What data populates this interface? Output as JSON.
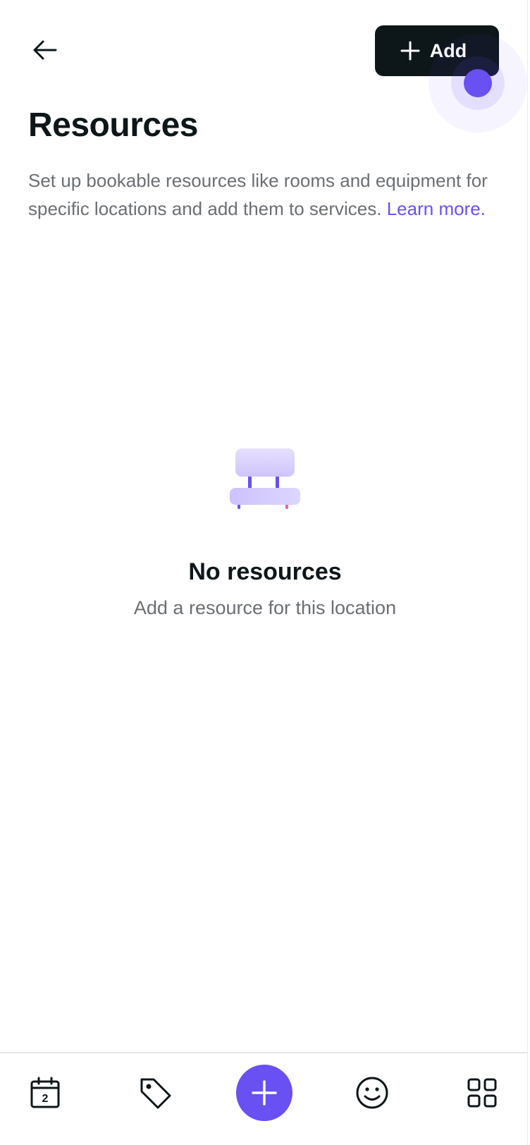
{
  "header": {
    "back_label": "Back",
    "add_label": "Add"
  },
  "page": {
    "title": "Resources",
    "description": "Set up bookable resources like rooms and equipment for specific locations and add them to services.",
    "learn_more": "Learn more."
  },
  "empty_state": {
    "icon": "chair-icon",
    "title": "No resources",
    "subtitle": "Add a resource for this location"
  },
  "bottom_nav": {
    "items": [
      {
        "name": "calendar",
        "icon": "calendar-icon",
        "day": "2"
      },
      {
        "name": "sales",
        "icon": "tag-icon"
      },
      {
        "name": "add",
        "icon": "plus-icon"
      },
      {
        "name": "clients",
        "icon": "smiley-icon"
      },
      {
        "name": "more",
        "icon": "grid-icon"
      }
    ]
  },
  "colors": {
    "accent": "#6950f3",
    "primary_button": "#0d1619",
    "text_primary": "#0d1619",
    "text_secondary": "#6b6f73",
    "divider": "#e6e6ea"
  }
}
